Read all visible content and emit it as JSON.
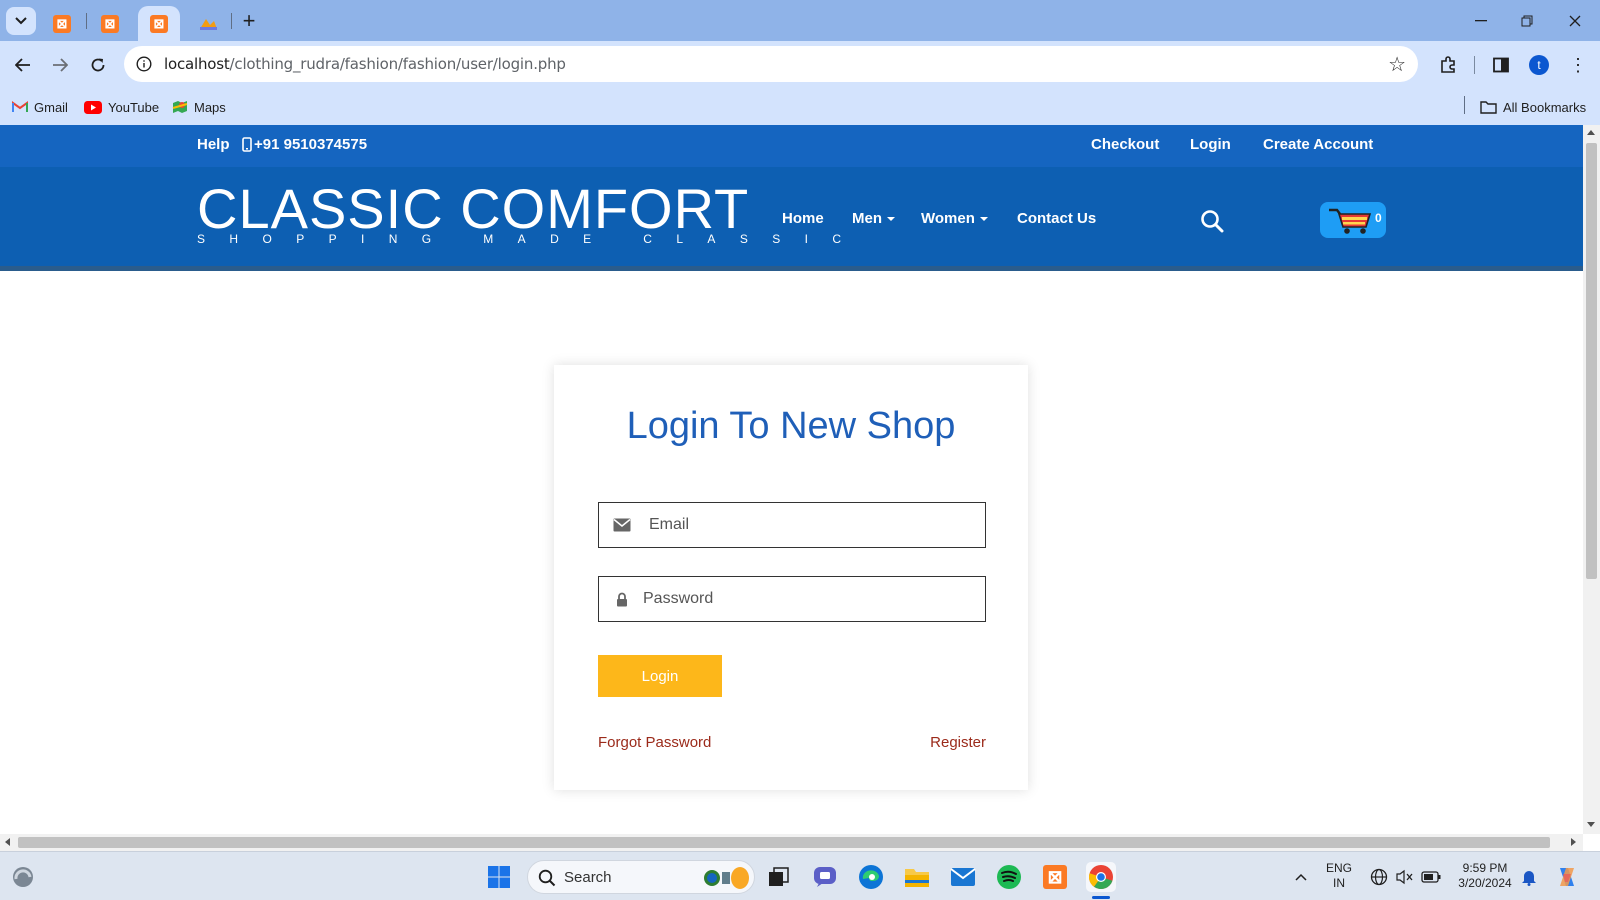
{
  "browser": {
    "url_host": "localhost",
    "url_path": "/clothing_rudra/fashion/fashion/user/login.php",
    "bookmarks": [
      {
        "label": "Gmail",
        "icon": "gmail-icon"
      },
      {
        "label": "YouTube",
        "icon": "youtube-icon"
      },
      {
        "label": "Maps",
        "icon": "maps-icon"
      }
    ],
    "all_bookmarks_label": "All Bookmarks",
    "profile_initial": "t"
  },
  "topbar": {
    "help_label": "Help",
    "phone": "+91 9510374575",
    "links": [
      "Checkout",
      "Login",
      "Create Account"
    ]
  },
  "header": {
    "brand_name": "CLASSIC COMFORT",
    "brand_tagline": "SHOPPING MADE CLASSIC",
    "nav": [
      {
        "label": "Home",
        "dropdown": false
      },
      {
        "label": "Men",
        "dropdown": true
      },
      {
        "label": "Women",
        "dropdown": true
      },
      {
        "label": "Contact Us",
        "dropdown": false
      }
    ],
    "cart_count": "0"
  },
  "login": {
    "title": "Login To New Shop",
    "email_placeholder": "Email",
    "password_placeholder": "Password",
    "login_button": "Login",
    "forgot_password": "Forgot Password",
    "register": "Register"
  },
  "taskbar": {
    "search_label": "Search",
    "lang_line1": "ENG",
    "lang_line2": "IN",
    "time": "9:59 PM",
    "date": "3/20/2024"
  },
  "colors": {
    "topbar_bg": "#1565c0",
    "header_bg": "#0d5fb2",
    "title_color": "#1f5fb8",
    "login_button": "#fdb71a",
    "link_color": "#9b2a1a",
    "cart_bg": "#1e9df5"
  }
}
